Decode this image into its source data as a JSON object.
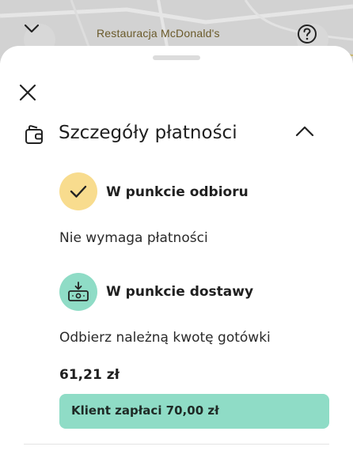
{
  "map": {
    "place_label": "Restauracja McDonald's",
    "collapse_icon": "chevron-down-icon",
    "help_icon": "help-circle-icon"
  },
  "sheet": {
    "close_icon": "close-icon",
    "section": {
      "title": "Szczegóły płatności",
      "icon": "wallet-icon",
      "toggle_icon": "chevron-up-icon"
    },
    "pickup": {
      "title": "W punkcie odbioru",
      "description": "Nie wymaga płatności",
      "icon": "checkmark-icon",
      "icon_color": "#f8dc8e"
    },
    "dropoff": {
      "title": "W punkcie dostawy",
      "description": "Odbierz należną kwotę gotówki",
      "amount": "61,21 zł",
      "client_pays": "Klient zapłaci 70,00 zł",
      "icon": "cash-download-icon",
      "icon_color": "#8fdcc6"
    }
  }
}
